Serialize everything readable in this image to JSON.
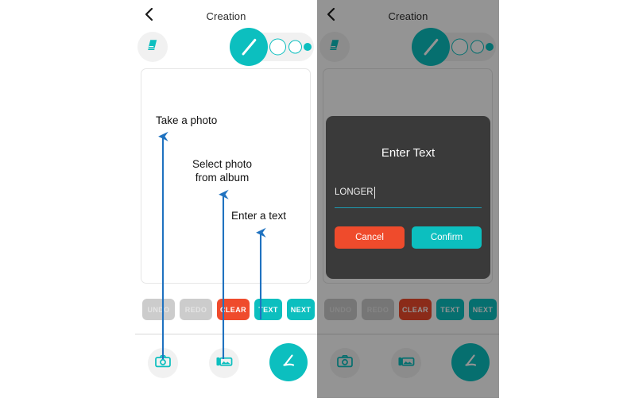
{
  "colors": {
    "teal": "#0cbfbf",
    "teal_dark": "#0e8080",
    "red": "#ef4b2c",
    "gray_disabled": "#cccccc",
    "dialog_bg": "#3a3a3a",
    "arrow_blue": "#1f72c0",
    "underline": "#1d9ab0",
    "canvas_border": "#e6e6e6"
  },
  "left_phone": {
    "header": {
      "back_icon": "chevron-left-icon",
      "title": "Creation"
    },
    "tools": {
      "eraser_icon": "eraser-icon",
      "pen_icon": "pen-stroke-icon",
      "brush_sizes": [
        "large",
        "medium",
        "small",
        "dot"
      ]
    },
    "canvas": {
      "label": "drawing-canvas"
    },
    "actions": [
      {
        "label": "UNDO",
        "state": "disabled"
      },
      {
        "label": "REDO",
        "state": "disabled"
      },
      {
        "label": "CLEAR",
        "state": "enabled"
      },
      {
        "label": "TEXT",
        "state": "enabled"
      },
      {
        "label": "NEXT",
        "state": "enabled"
      }
    ],
    "bottom_nav": [
      {
        "icon": "camera-icon",
        "name": "take-photo"
      },
      {
        "icon": "gallery-icon",
        "name": "select-photo"
      },
      {
        "icon": "pen-stroke-icon",
        "name": "draw"
      }
    ]
  },
  "right_phone": {
    "header": {
      "back_icon": "chevron-left-icon",
      "title": "Creation"
    },
    "actions": [
      {
        "label": "UNDO",
        "state": "disabled"
      },
      {
        "label": "REDO",
        "state": "disabled"
      },
      {
        "label": "CLEAR",
        "state": "enabled"
      },
      {
        "label": "TEXT",
        "state": "enabled"
      },
      {
        "label": "NEXT",
        "state": "enabled"
      }
    ],
    "dialog": {
      "title": "Enter Text",
      "input_value": "LONGER",
      "input_placeholder": "",
      "cancel_label": "Cancel",
      "confirm_label": "Confirm"
    }
  },
  "annotations": [
    {
      "text": "Take a photo"
    },
    {
      "text": "Select photo\nfrom album"
    },
    {
      "text": "Enter a text"
    }
  ]
}
